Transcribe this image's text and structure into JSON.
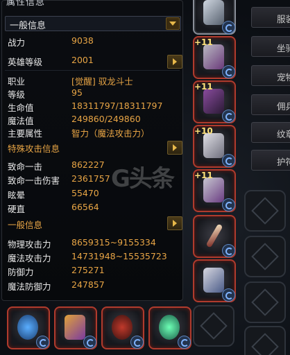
{
  "header_cut": "属性信息",
  "selector": {
    "value": "一般信息"
  },
  "basic": [
    {
      "label": "战力",
      "value": "9038"
    },
    {
      "label": "英雄等级",
      "value": "2001"
    }
  ],
  "profile": [
    {
      "label": "职业",
      "value": "[觉醒] 驭龙斗士"
    },
    {
      "label": "等级",
      "value": "95"
    },
    {
      "label": "生命值",
      "value": "18311797/18311797"
    },
    {
      "label": "魔法值",
      "value": "249860/249860"
    },
    {
      "label": "主要属性",
      "value": "智力（魔法攻击力）"
    }
  ],
  "special_header": "特殊攻击信息",
  "special": [
    {
      "label": "致命一击",
      "value": "862227"
    },
    {
      "label": "致命一击伤害",
      "value": "2361757"
    },
    {
      "label": "眩晕",
      "value": "55470"
    },
    {
      "label": "硬直",
      "value": "66564"
    }
  ],
  "general_header": "一般信息",
  "general": [
    {
      "label": "物理攻击力",
      "value": "8659315~9155334"
    },
    {
      "label": "魔法攻击力",
      "value": "14731948~15535723"
    },
    {
      "label": "防御力",
      "value": "275271"
    },
    {
      "label": "魔法防御力",
      "value": "247857"
    }
  ],
  "watermark": "G头条",
  "equipment": {
    "right_column": [
      {
        "icon": "helmet-icon",
        "plus": ""
      },
      {
        "icon": "chest-armor-icon",
        "plus": "+11"
      },
      {
        "icon": "shoulder-armor-icon",
        "plus": "+11"
      },
      {
        "icon": "gauntlet-icon",
        "plus": "+10"
      },
      {
        "icon": "boots-icon",
        "plus": "+11"
      },
      {
        "icon": "weapon-icon",
        "plus": ""
      },
      {
        "icon": "belt-icon",
        "plus": ""
      }
    ],
    "bottom_row": [
      {
        "icon": "necklace-icon"
      },
      {
        "icon": "earring-icon"
      },
      {
        "icon": "bracelet-icon"
      },
      {
        "icon": "ring-icon"
      }
    ]
  },
  "menu_tabs": [
    {
      "label": "服装"
    },
    {
      "label": "坐骑"
    },
    {
      "label": "宠物"
    },
    {
      "label": "佣兵"
    },
    {
      "label": "纹章"
    },
    {
      "label": "护符"
    }
  ],
  "colors": {
    "value": "#e8a545",
    "label": "#e6e6e6",
    "plus": "#ffe27a",
    "accent_blue": "#5d86c2"
  }
}
